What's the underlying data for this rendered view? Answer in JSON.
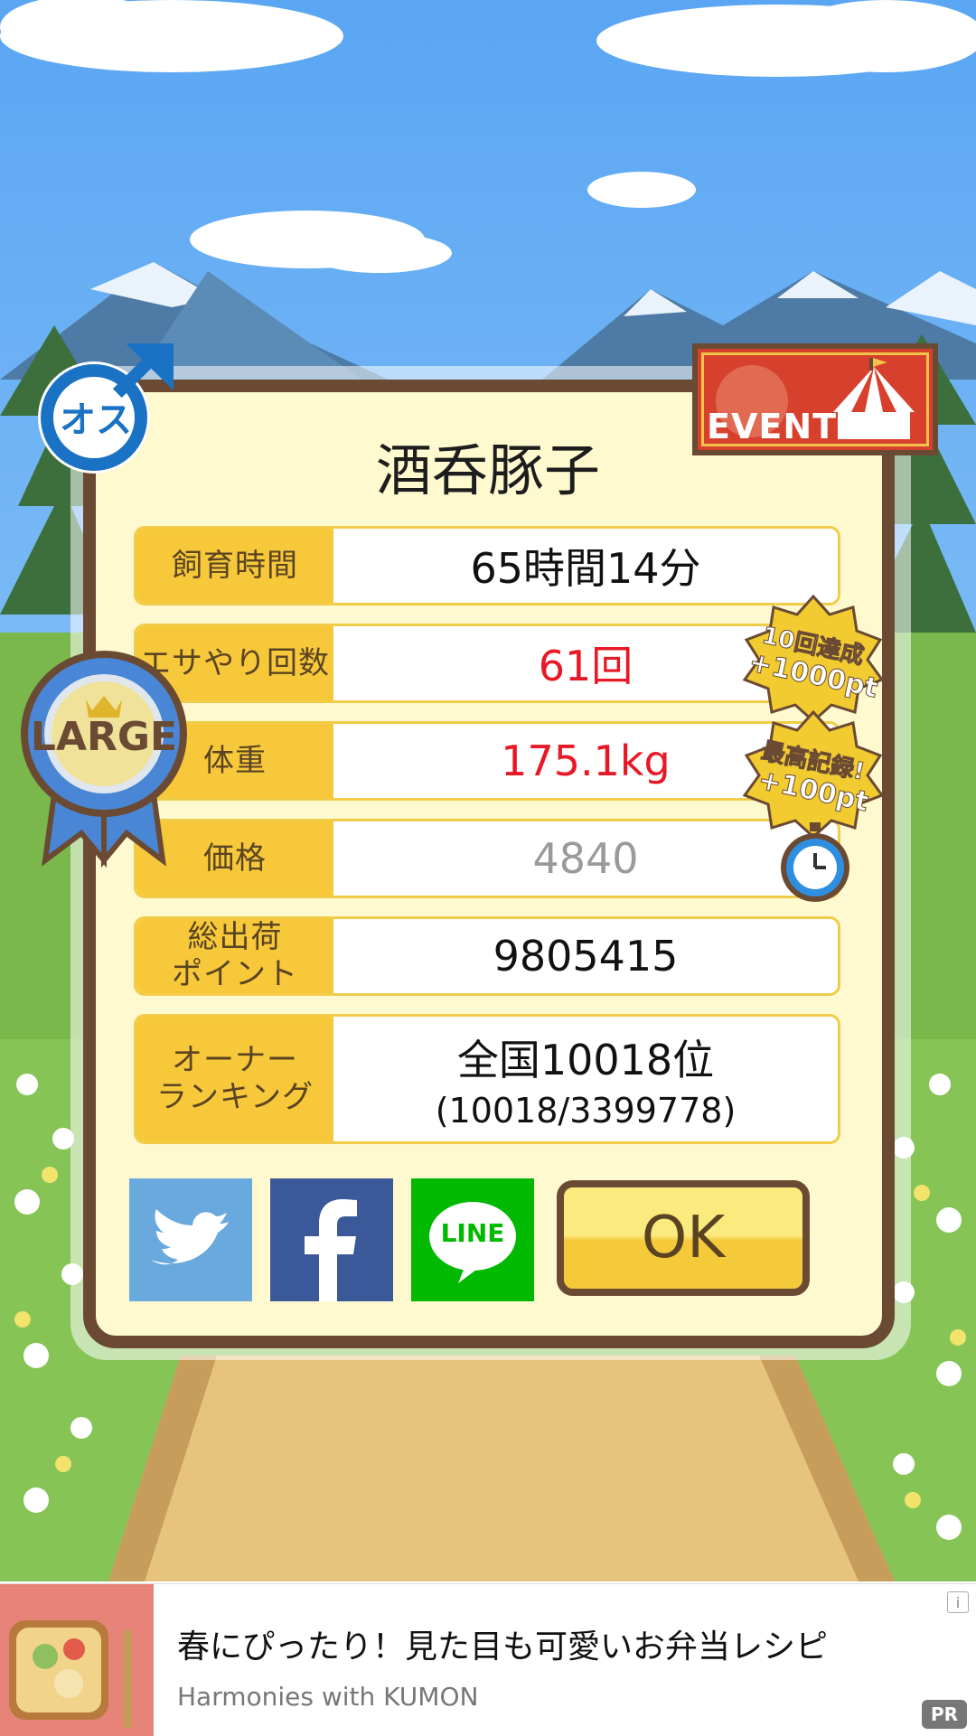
{
  "pig_name": "酒呑豚子",
  "gender_badge": {
    "text": "オス",
    "icon": "male-symbol-icon"
  },
  "event_badge": {
    "text": "EVENT",
    "icon": "circus-tent-icon"
  },
  "size_badge": {
    "text": "LARGE",
    "icon": "ribbon-medal-icon"
  },
  "stats": [
    {
      "label": "飼育時間",
      "value": "65時間14分"
    },
    {
      "label": "エサやり回数",
      "value": "61回"
    },
    {
      "label": "体重",
      "value": "175.1kg"
    },
    {
      "label": "価格",
      "value": "4840"
    },
    {
      "label_line1": "総出荷",
      "label_line2": "ポイント",
      "value": "9805415"
    },
    {
      "label_line1": "オーナー",
      "label_line2": "ランキング",
      "value_line1": "全国10018位",
      "value_line2": "(10018/3399778)"
    }
  ],
  "achievement_badges": [
    {
      "line1": "10回達成",
      "line2": "+1000pt"
    },
    {
      "line1": "最高記録!",
      "line2": "+100pt"
    }
  ],
  "timer_icon": "stopwatch-icon",
  "share": {
    "twitter_icon": "twitter-bird-icon",
    "facebook_icon": "facebook-f-icon",
    "line_icon": "line-logo-icon",
    "line_text": "LINE"
  },
  "ok_button": "OK",
  "ad": {
    "title": "春にぴったり！見た目も可愛いお弁当レシピ",
    "subtitle": "Harmonies with KUMON",
    "pr_label": "PR",
    "info_label": "i"
  },
  "colors": {
    "sky": "#6eb3f5",
    "frame": "#6a4a33",
    "panel": "#fff9cf",
    "label_bg": "#f7c93a",
    "highlight_red": "#e81827",
    "twitter": "#6aa9de",
    "facebook": "#3b5998",
    "line": "#00b900"
  }
}
